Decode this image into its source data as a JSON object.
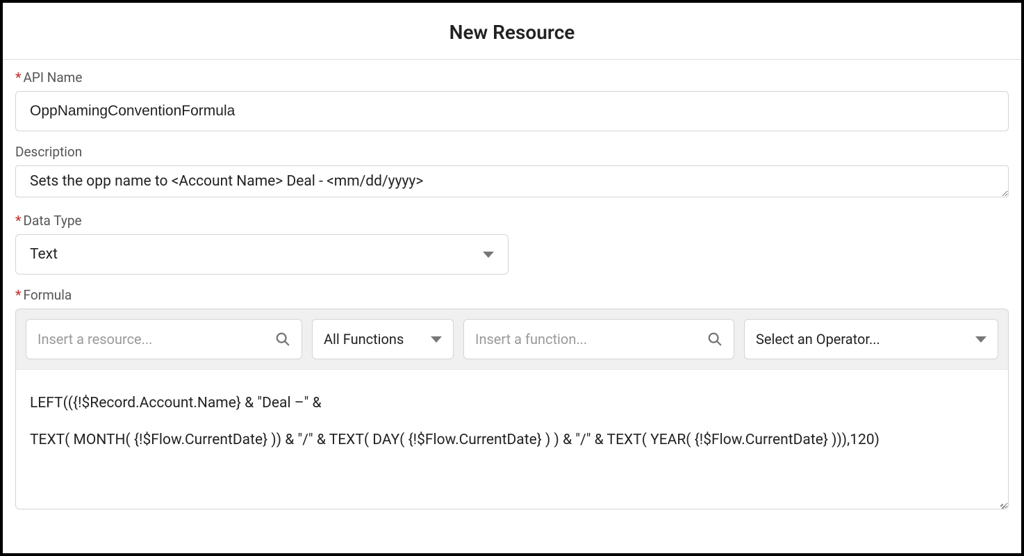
{
  "header": {
    "title": "New Resource"
  },
  "api_name": {
    "label": "API Name",
    "value": "OppNamingConventionFormula"
  },
  "description": {
    "label": "Description",
    "value": "Sets the opp name to <Account Name> Deal - <mm/dd/yyyy>"
  },
  "data_type": {
    "label": "Data Type",
    "value": "Text"
  },
  "formula": {
    "label": "Formula",
    "toolbar": {
      "resource_placeholder": "Insert a resource...",
      "functions_filter": "All Functions",
      "function_placeholder": "Insert a function...",
      "operator_placeholder": "Select an Operator..."
    },
    "body_line1": "LEFT(({!$Record.Account.Name} & \"Deal –\" &",
    "body_line2": "TEXT( MONTH( {!$Flow.CurrentDate} )) & \"/\" & TEXT( DAY( {!$Flow.CurrentDate} ) ) & \"/\" & TEXT( YEAR( {!$Flow.CurrentDate} ))),120)"
  }
}
